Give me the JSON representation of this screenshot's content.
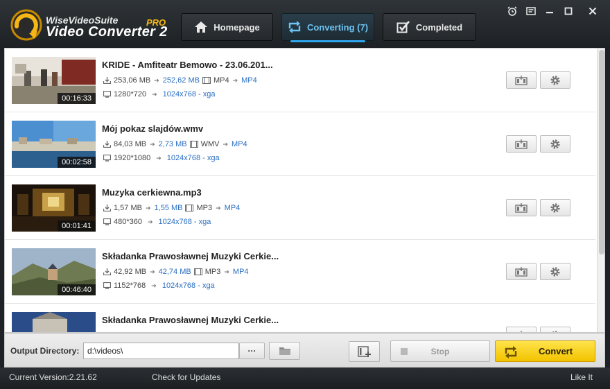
{
  "app": {
    "brand_top": "WiseVideoSuite",
    "brand_main": "Video Converter 2",
    "brand_pro": "PRO"
  },
  "nav": {
    "homepage": "Homepage",
    "converting": "Converting (7)",
    "completed": "Completed",
    "active": "converting"
  },
  "items": [
    {
      "title": "KRIDE - Amfiteatr Bemowo - 23.06.201...",
      "duration": "00:16:33",
      "size_from": "253,06 MB",
      "size_to": "252,62 MB",
      "format_from": "MP4",
      "format_to": "MP4",
      "res_from": "1280*720",
      "res_to": "1024x768 - xga"
    },
    {
      "title": "Mój pokaz slajdów.wmv",
      "duration": "00:02:58",
      "size_from": "84,03 MB",
      "size_to": "2,73 MB",
      "format_from": "WMV",
      "format_to": "MP4",
      "res_from": "1920*1080",
      "res_to": "1024x768 - xga"
    },
    {
      "title": "Muzyka cerkiewna.mp3",
      "duration": "00:01:41",
      "size_from": "1,57 MB",
      "size_to": "1,55 MB",
      "format_from": "MP3",
      "format_to": "MP4",
      "res_from": "480*360",
      "res_to": "1024x768 - xga"
    },
    {
      "title": "Składanka Prawosławnej Muzyki Cerkie...",
      "duration": "00:46:40",
      "size_from": "42,92 MB",
      "size_to": "42,74 MB",
      "format_from": "MP3",
      "format_to": "MP4",
      "res_from": "1152*768",
      "res_to": "1024x768 - xga"
    },
    {
      "title": "Składanka Prawosławnej Muzyki Cerkie..."
    }
  ],
  "bottom": {
    "output_label": "Output Directory:",
    "output_value": "d:\\videos\\",
    "browse_label": "···",
    "stop_label": "Stop",
    "convert_label": "Convert"
  },
  "status": {
    "version": "Current Version:2.21.62",
    "check_updates": "Check for Updates",
    "like": "Like It"
  },
  "colors": {
    "accent_blue": "#2ea8f0",
    "link_blue": "#2a6ec1",
    "convert_yellow": "#f6cf1c",
    "pro_orange": "#f6b716"
  },
  "icons": [
    "logo-icon",
    "home-icon",
    "convert-arrows-icon",
    "checkbox-icon",
    "alarm-icon",
    "feedback-icon",
    "minimize-icon",
    "maximize-icon",
    "close-icon",
    "size-icon",
    "film-icon",
    "screen-icon",
    "edit-clip-icon",
    "gear-icon",
    "folder-icon",
    "add-queue-icon",
    "stop-icon"
  ]
}
